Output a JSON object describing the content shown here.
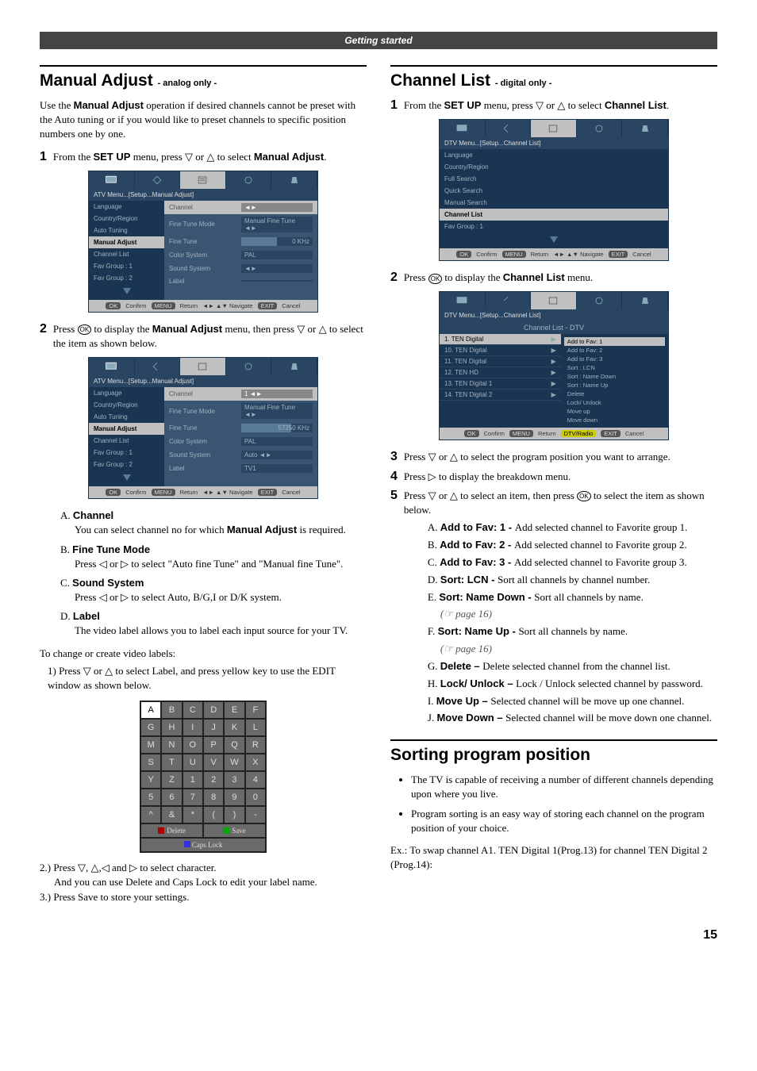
{
  "header": {
    "title": "Getting started"
  },
  "page_number": "15",
  "left": {
    "manual_adjust": {
      "heading": "Manual Adjust",
      "heading_sub": " - analog only -",
      "intro": "Use the Manual Adjust operation if desired channels cannot be preset with the Auto tuning or if you would like to preset channels to specific position numbers one by one.",
      "step1_pre": "From the ",
      "step1_b1": "SET UP",
      "step1_mid": " menu, press ▽ or △ to select ",
      "step1_b2": "Manual Adjust",
      "step1_post": ".",
      "step2_pre": "Press ",
      "step2_mid": " to display the ",
      "step2_b": "Manual Adjust",
      "step2_post": " menu, then press ▽ or △ to select the item as shown below.",
      "osd": {
        "breadcrumb": "ATV Menu...[Setup...Manual Adjust]",
        "side": [
          "Language",
          "Country/Region",
          "Auto Tuning",
          "Manual Adjust",
          "Channel List",
          "Fav Group : 1",
          "Fav Group : 2"
        ],
        "rows1": [
          {
            "label": "Channel",
            "val": "◄►"
          },
          {
            "label": "Fine Tune Mode",
            "val": "Manual Fine Tune ◄►"
          },
          {
            "label": "Fine Tune",
            "val": "0 KHz",
            "bar": true
          },
          {
            "label": "Color System",
            "val": "PAL"
          },
          {
            "label": "Sound System",
            "val": "◄►"
          },
          {
            "label": "Label",
            "val": ""
          }
        ],
        "rows2": [
          {
            "label": "Channel",
            "val": "1          ◄►"
          },
          {
            "label": "Fine Tune Mode",
            "val": "Manual Fine Tune ◄►"
          },
          {
            "label": "Fine Tune",
            "val": "57250 KHz",
            "bar2": true
          },
          {
            "label": "Color System",
            "val": "PAL"
          },
          {
            "label": "Sound System",
            "val": "Auto       ◄►"
          },
          {
            "label": "Label",
            "val": "TV1"
          }
        ],
        "footer": {
          "ok": "OK",
          "confirm": "Confirm",
          "menu": "MENU",
          "return": "Return",
          "nav": "◄► ▲▼ Navigate",
          "exit": "EXIT",
          "cancel": "Cancel"
        }
      },
      "itemA_h": "Channel",
      "itemA_t": "You can select channel no for which Manual Adjust is required.",
      "itemB_h": "Fine Tune Mode",
      "itemB_t": "Press ◁ or ▷ to select \"Auto fine Tune\" and \"Manual fine Tune\".",
      "itemC_h": "Sound System",
      "itemC_t": "Press ◁ or ▷ to select Auto, B/G,I or D/K system.",
      "itemD_h": "Label",
      "itemD_t": "The video label allows you to label each input source for your TV.",
      "labels_intro": "To change or create video labels:",
      "labels_1": "1) Press ▽ or △ to select Label, and press yellow key to use the EDIT window as shown below.",
      "labels_2": "2.) Press ▽, △,◁ and ▷ to select character.",
      "labels_2b": "And you can use Delete and Caps Lock to edit your label name.",
      "labels_3": "3.) Press Save to store your settings.",
      "vkbd": {
        "keys": [
          "A",
          "B",
          "C",
          "D",
          "E",
          "F",
          "G",
          "H",
          "I",
          "J",
          "K",
          "L",
          "M",
          "N",
          "O",
          "P",
          "Q",
          "R",
          "S",
          "T",
          "U",
          "V",
          "W",
          "X",
          "Y",
          "Z",
          "1",
          "2",
          "3",
          "4",
          "5",
          "6",
          "7",
          "8",
          "9",
          "0",
          "^",
          "&",
          "*",
          "(",
          ")",
          "-"
        ],
        "delete": "Delete",
        "save": "Save",
        "caps": "Caps Lock"
      }
    }
  },
  "right": {
    "channel_list": {
      "heading": "Channel List",
      "heading_sub": " - digital only -",
      "step1_pre": "From the ",
      "step1_b1": "SET UP",
      "step1_mid": " menu, press ▽ or △ to select ",
      "step1_b2": "Channel List",
      "step1_post": ".",
      "osd1": {
        "breadcrumb": "DTV Menu...[Setup...Channel List]",
        "side": [
          "Language",
          "Country/Region",
          "Full Search",
          "Quick Search",
          "Manual Search",
          "Channel List",
          "Fav Group : 1"
        ]
      },
      "step2_pre": "Press ",
      "step2_mid": " to display the ",
      "step2_b": "Channel List",
      "step2_post": " menu.",
      "osd2": {
        "breadcrumb": "DTV Menu...[Setup...Channel List]",
        "title": "Channel List - DTV",
        "left": [
          "1. TEN Digital",
          "10. TEN Digital",
          "11. TEN Digital",
          "12. TEN HD",
          "13. TEN Digital  1",
          "14. TEN Digital  2"
        ],
        "right": [
          "Add to Fav: 1",
          "Add to Fav: 2",
          "Add to Fav: 3",
          "Sort : LCN",
          "Sort : Name Down",
          "Sort : Name Up",
          "Delete",
          "Lock/ Unlock",
          "Move up",
          "Move down"
        ],
        "footer_extra": "DTV/Radio"
      },
      "step3": "Press ▽ or △  to select the program position you want to arrange.",
      "step4": "Press ▷ to display the breakdown menu.",
      "step5_pre": "Press ▽ or △  to select an item, then press ",
      "step5_post": " to select the item as shown below.",
      "items": [
        {
          "p": "A.",
          "b": "Add to Fav: 1 - ",
          "t": "Add selected channel to Favorite group 1."
        },
        {
          "p": "B.",
          "b": "Add to Fav: 2 - ",
          "t": "Add selected channel to Favorite group 2."
        },
        {
          "p": "C.",
          "b": "Add to Fav: 3 - ",
          "t": "Add selected channel to Favorite group 3."
        },
        {
          "p": "D.",
          "b": "Sort: LCN - ",
          "t": "Sort all channels by channel number."
        },
        {
          "p": "E.",
          "b": "Sort: Name Down - ",
          "t": "Sort all channels by name."
        },
        {
          "p": "F.",
          "b": "Sort: Name Up - ",
          "t": "Sort all channels by name."
        },
        {
          "p": "G.",
          "b": "Delete – ",
          "t": "Delete selected channel from the channel list."
        },
        {
          "p": "H.",
          "b": "Lock/ Unlock – ",
          "t": "Lock / Unlock selected channel by password."
        },
        {
          "p": "I.",
          "b": "Move Up – ",
          "t": "Selected channel will be move up one channel."
        },
        {
          "p": "J.",
          "b": "Move Down – ",
          "t": "Selected channel will be move down one channel."
        }
      ],
      "page_ref": "(☞ page 16)"
    },
    "sorting": {
      "heading": "Sorting program position",
      "b1": "The TV is capable of receiving a number of different channels depending upon where you live.",
      "b2": "Program sorting is an easy way of storing each channel on the program position of your choice.",
      "ex": "Ex.: To swap channel A1. TEN Digital 1(Prog.13) for channel TEN Digital 2 (Prog.14):"
    }
  }
}
